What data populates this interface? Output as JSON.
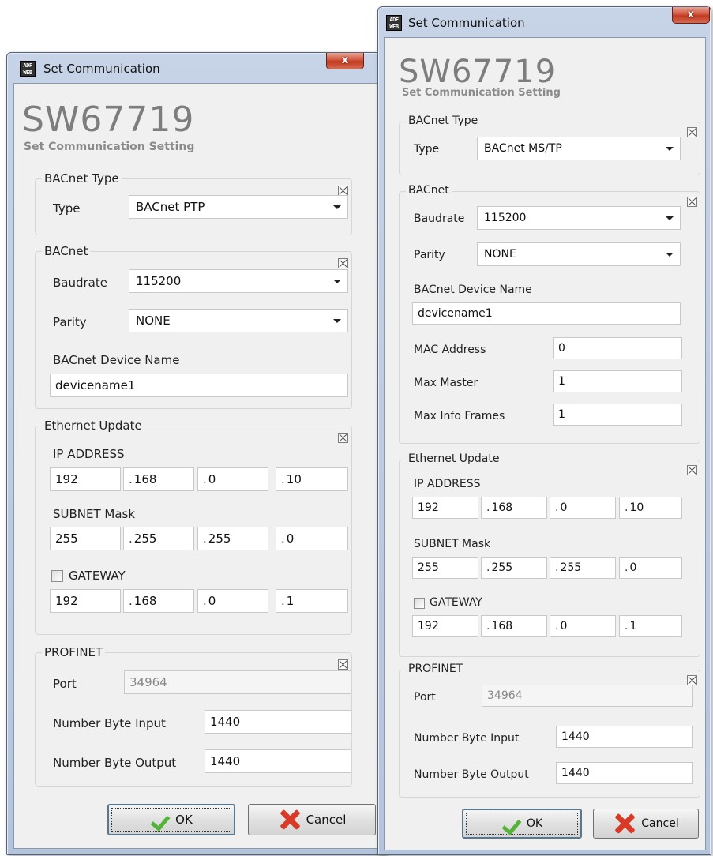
{
  "left": {
    "title": "Set Communication",
    "close_label": "x",
    "brand": "SW67719",
    "subtitle": "Set Communication Setting",
    "bacnet_type": {
      "group_title": "BACnet Type",
      "type_label": "Type",
      "type_value": "BACnet PTP"
    },
    "bacnet": {
      "group_title": "BACnet",
      "baudrate_label": "Baudrate",
      "baudrate_value": "115200",
      "parity_label": "Parity",
      "parity_value": "NONE",
      "device_name_label": "BACnet Device Name",
      "device_name_value": "devicename1"
    },
    "ethernet": {
      "group_title": "Ethernet Update",
      "ip_label": "IP ADDRESS",
      "ip": [
        "192",
        "168",
        "0",
        "10"
      ],
      "subnet_label": "SUBNET Mask",
      "subnet": [
        "255",
        "255",
        "255",
        "0"
      ],
      "gateway_label": "GATEWAY",
      "gateway": [
        "192",
        "168",
        "0",
        "1"
      ]
    },
    "profinet": {
      "group_title": "PROFINET",
      "port_label": "Port",
      "port_value": "34964",
      "in_label": "Number Byte Input",
      "in_value": "1440",
      "out_label": "Number Byte Output",
      "out_value": "1440"
    },
    "ok_label": "OK",
    "cancel_label": "Cancel"
  },
  "right": {
    "title": "Set Communication",
    "close_label": "x",
    "brand": "SW67719",
    "subtitle": "Set Communication Setting",
    "bacnet_type": {
      "group_title": "BACnet Type",
      "type_label": "Type",
      "type_value": "BACnet MS/TP"
    },
    "bacnet": {
      "group_title": "BACnet",
      "baudrate_label": "Baudrate",
      "baudrate_value": "115200",
      "parity_label": "Parity",
      "parity_value": "NONE",
      "device_name_label": "BACnet Device Name",
      "device_name_value": "devicename1",
      "mac_label": "MAC Address",
      "mac_value": "0",
      "max_master_label": "Max Master",
      "max_master_value": "1",
      "max_info_label": "Max Info Frames",
      "max_info_value": "1"
    },
    "ethernet": {
      "group_title": "Ethernet Update",
      "ip_label": "IP ADDRESS",
      "ip": [
        "192",
        "168",
        "0",
        "10"
      ],
      "subnet_label": "SUBNET Mask",
      "subnet": [
        "255",
        "255",
        "255",
        "0"
      ],
      "gateway_label": "GATEWAY",
      "gateway": [
        "192",
        "168",
        "0",
        "1"
      ]
    },
    "profinet": {
      "group_title": "PROFINET",
      "port_label": "Port",
      "port_value": "34964",
      "in_label": "Number Byte Input",
      "in_value": "1440",
      "out_label": "Number Byte Output",
      "out_value": "1440"
    },
    "ok_label": "OK",
    "cancel_label": "Cancel"
  },
  "app_icon_text": "ADF WEB"
}
